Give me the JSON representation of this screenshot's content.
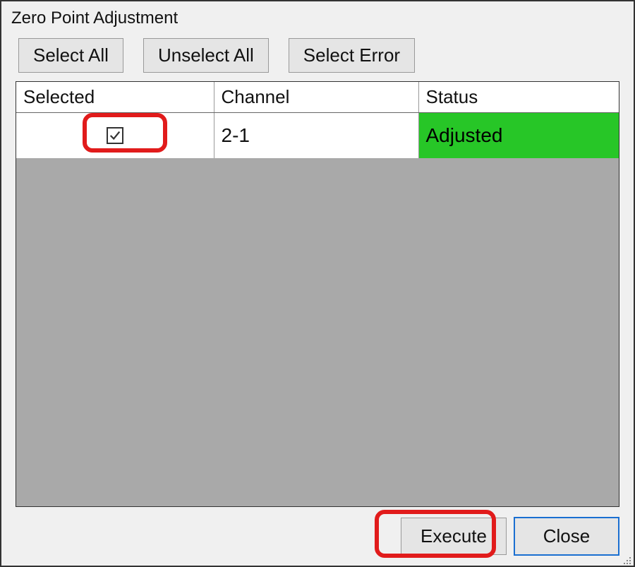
{
  "window": {
    "title": "Zero Point Adjustment"
  },
  "toolbar": {
    "select_all": "Select All",
    "unselect_all": "Unselect All",
    "select_error": "Select Error"
  },
  "table": {
    "headers": {
      "selected": "Selected",
      "channel": "Channel",
      "status": "Status"
    },
    "rows": [
      {
        "selected": true,
        "channel": "2-1",
        "status": "Adjusted",
        "status_class": "adjusted"
      }
    ]
  },
  "footer": {
    "execute": "Execute",
    "close": "Close"
  },
  "colors": {
    "status_adjusted_bg": "#27c627",
    "highlight": "#e11b1b"
  }
}
